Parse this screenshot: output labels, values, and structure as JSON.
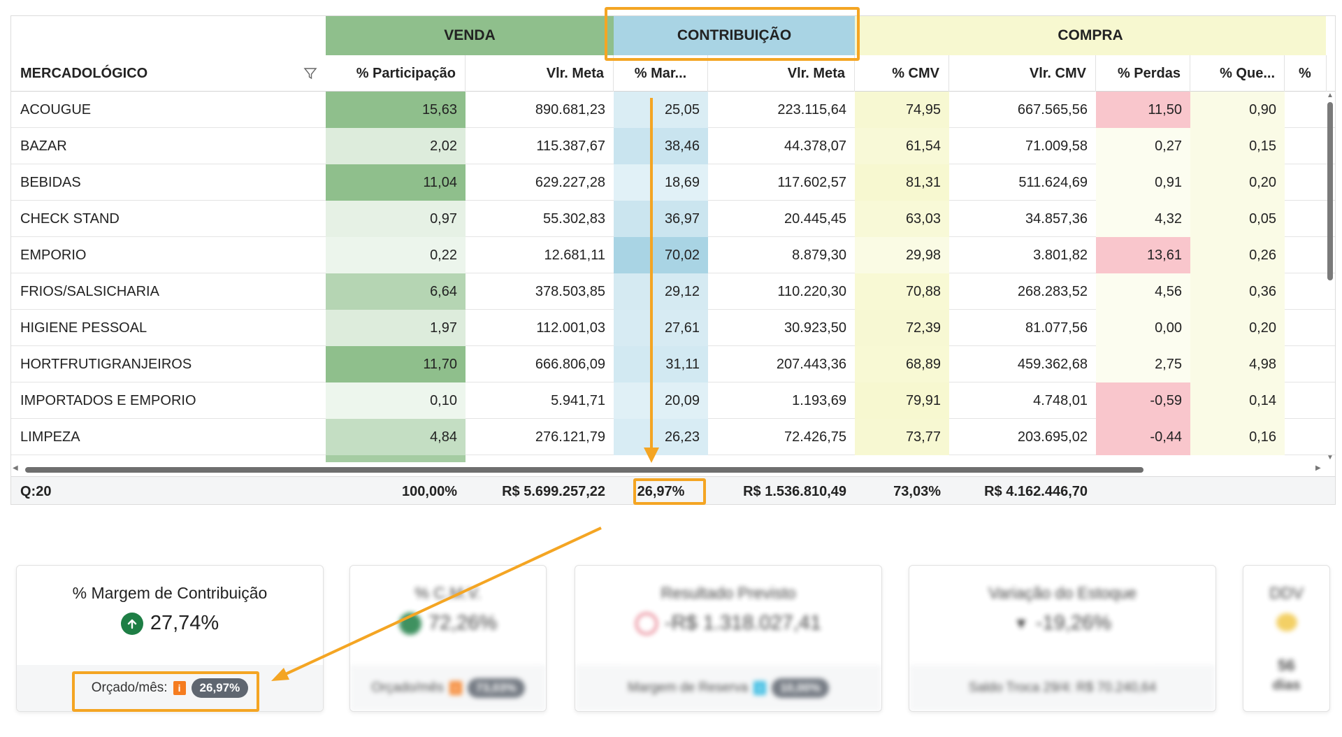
{
  "groups": {
    "venda": "VENDA",
    "contribuicao": "CONTRIBUIÇÃO",
    "compra": "COMPRA"
  },
  "columns": [
    "MERCADOLÓGICO",
    "% Participação",
    "Vlr. Meta",
    "% Mar...",
    "Vlr. Meta",
    "% CMV",
    "Vlr. CMV",
    "% Perdas",
    "% Que...",
    "%"
  ],
  "rows": [
    [
      "ACOUGUE",
      "15,63",
      "890.681,23",
      "25,05",
      "223.115,64",
      "74,95",
      "667.565,56",
      "11,50",
      "0,90"
    ],
    [
      "BAZAR",
      "2,02",
      "115.387,67",
      "38,46",
      "44.378,07",
      "61,54",
      "71.009,58",
      "0,27",
      "0,15"
    ],
    [
      "BEBIDAS",
      "11,04",
      "629.227,28",
      "18,69",
      "117.602,57",
      "81,31",
      "511.624,69",
      "0,91",
      "0,20"
    ],
    [
      "CHECK STAND",
      "0,97",
      "55.302,83",
      "36,97",
      "20.445,45",
      "63,03",
      "34.857,36",
      "4,32",
      "0,05"
    ],
    [
      "EMPORIO",
      "0,22",
      "12.681,11",
      "70,02",
      "8.879,30",
      "29,98",
      "3.801,82",
      "13,61",
      "0,26"
    ],
    [
      "FRIOS/SALSICHARIA",
      "6,64",
      "378.503,85",
      "29,12",
      "110.220,30",
      "70,88",
      "268.283,52",
      "4,56",
      "0,36"
    ],
    [
      "HIGIENE PESSOAL",
      "1,97",
      "112.001,03",
      "27,61",
      "30.923,50",
      "72,39",
      "81.077,56",
      "0,00",
      "0,20"
    ],
    [
      "HORTFRUTIGRANJEIROS",
      "11,70",
      "666.806,09",
      "31,11",
      "207.443,36",
      "68,89",
      "459.362,68",
      "2,75",
      "4,98"
    ],
    [
      "IMPORTADOS E EMPORIO",
      "0,10",
      "5.941,71",
      "20,09",
      "1.193,69",
      "79,91",
      "4.748,01",
      "-0,59",
      "0,14"
    ],
    [
      "LIMPEZA",
      "4,84",
      "276.121,79",
      "26,23",
      "72.426,75",
      "73,77",
      "203.695,02",
      "-0,44",
      "0,16"
    ]
  ],
  "footer": {
    "count": "Q:20",
    "participacao": "100,00%",
    "vlr_meta_venda": "R$ 5.699.257,22",
    "margem": "26,97%",
    "vlr_meta_contrib": "R$ 1.536.810,49",
    "cmv": "73,03%",
    "vlr_cmv": "R$ 4.162.446,70"
  },
  "cards": {
    "margem": {
      "title": "% Margem de Contribuição",
      "value": "27,74%",
      "foot_label": "Orçado/mês:",
      "foot_value": "26,97%",
      "icon": "arrow-up-circle-icon"
    },
    "cmv": {
      "title": "% C.M.V.",
      "value": "72,26%",
      "foot_label": "Orçado/mês",
      "foot_value": "73,03%"
    },
    "resultado": {
      "title": "Resultado Previsto",
      "value": "-R$ 1.318.027,41",
      "foot_label": "Margem de Reserva",
      "foot_value": "10,00%"
    },
    "estoque": {
      "title": "Variação do Estoque",
      "value": "-19,26%",
      "foot_label": "Saldo Troca 29/4: R$ 70.240,64"
    },
    "ddv": {
      "title": "DDV",
      "value_num": "56",
      "value_unit": "dias"
    }
  },
  "colors": {
    "accent_orange": "#f4a523",
    "venda_green": "#8fbf8c",
    "contrib_blue": "#a9d4e4",
    "compra_yellow": "#f7f8d0",
    "perdas_red": "#f9c6cc",
    "positive_green": "#1e7e45"
  }
}
